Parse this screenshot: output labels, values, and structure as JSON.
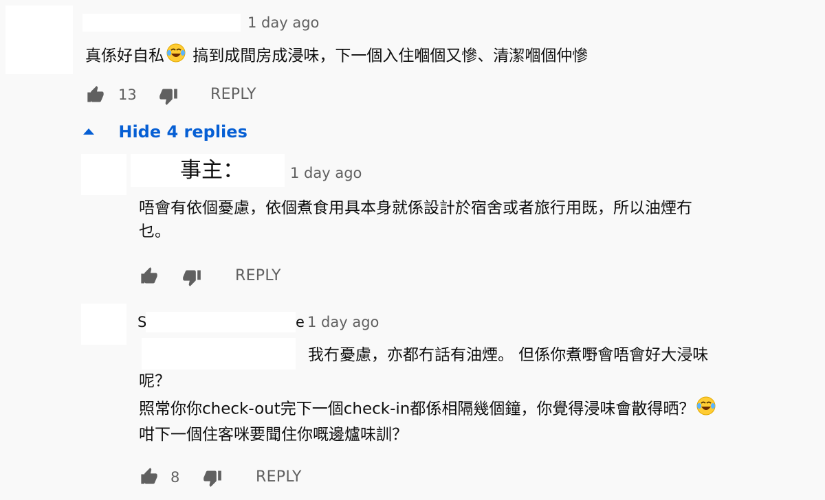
{
  "comments": [
    {
      "time": "1 day ago",
      "text_pre": "真係好自私",
      "text_post": "搞到成間房成浸味，下一個入住嗰個又慘、清潔嗰個仲慘",
      "likes": "13",
      "reply_label": "REPLY",
      "toggle_label": "Hide 4 replies"
    },
    {
      "author": "事主：",
      "time": "1 day ago",
      "lines": [
        "唔會有依個憂慮，依個煮食用具本身就係設計於宿舍或者旅行用既，所以油煙冇",
        "乜。"
      ],
      "reply_label": "REPLY"
    },
    {
      "author_prefix": "S",
      "author_suffix": "e",
      "time": "1 day ago",
      "line1": "我冇憂慮，亦都冇話有油煙。 但係你煮嘢會唔會好大浸味",
      "line2": "呢？",
      "line3": "照常你你check-out完下一個check-in都係相隔幾個鐘，你覺得浸味會散得晒？",
      "line4": "咁下一個住客咪要聞住你嘅邊爐味訓？",
      "likes": "8",
      "reply_label": "REPLY"
    }
  ],
  "icons": [
    "thumb-up-icon",
    "thumb-down-icon",
    "chevron-up-icon",
    "laughing-emoji-icon"
  ]
}
